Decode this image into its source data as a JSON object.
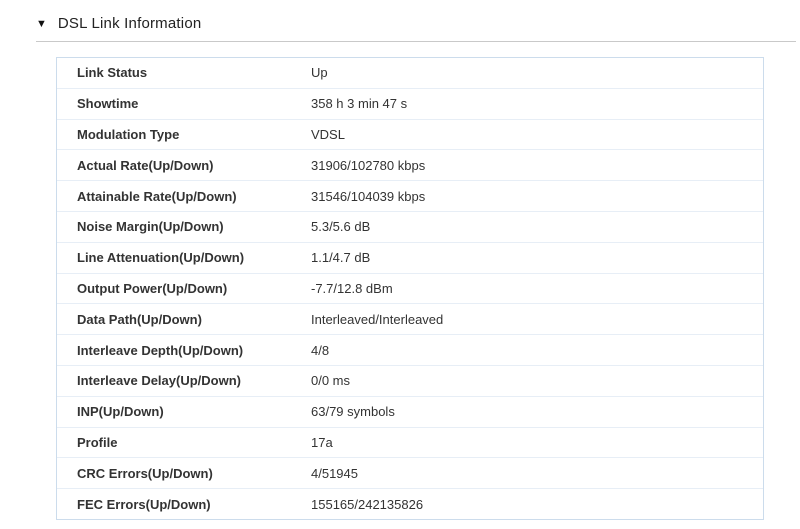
{
  "section": {
    "collapse_icon": "▼",
    "title": "DSL Link Information"
  },
  "colors": {
    "table_border": "#ccdcec",
    "row_divider": "#e7eef6",
    "header_divider": "#c9c9c9",
    "text": "#333333"
  },
  "table": {
    "rows": [
      {
        "label": "Link Status",
        "value": "Up"
      },
      {
        "label": "Showtime",
        "value": "358 h 3 min 47 s"
      },
      {
        "label": "Modulation Type",
        "value": "VDSL"
      },
      {
        "label": "Actual Rate(Up/Down)",
        "value": "31906/102780 kbps"
      },
      {
        "label": "Attainable Rate(Up/Down)",
        "value": "31546/104039 kbps"
      },
      {
        "label": "Noise Margin(Up/Down)",
        "value": "5.3/5.6 dB"
      },
      {
        "label": "Line Attenuation(Up/Down)",
        "value": "1.1/4.7 dB"
      },
      {
        "label": "Output Power(Up/Down)",
        "value": "-7.7/12.8 dBm"
      },
      {
        "label": "Data Path(Up/Down)",
        "value": "Interleaved/Interleaved"
      },
      {
        "label": "Interleave Depth(Up/Down)",
        "value": "4/8"
      },
      {
        "label": "Interleave Delay(Up/Down)",
        "value": "0/0 ms"
      },
      {
        "label": "INP(Up/Down)",
        "value": "63/79 symbols"
      },
      {
        "label": "Profile",
        "value": "17a"
      },
      {
        "label": "CRC Errors(Up/Down)",
        "value": "4/51945"
      },
      {
        "label": "FEC Errors(Up/Down)",
        "value": "155165/242135826"
      }
    ]
  }
}
